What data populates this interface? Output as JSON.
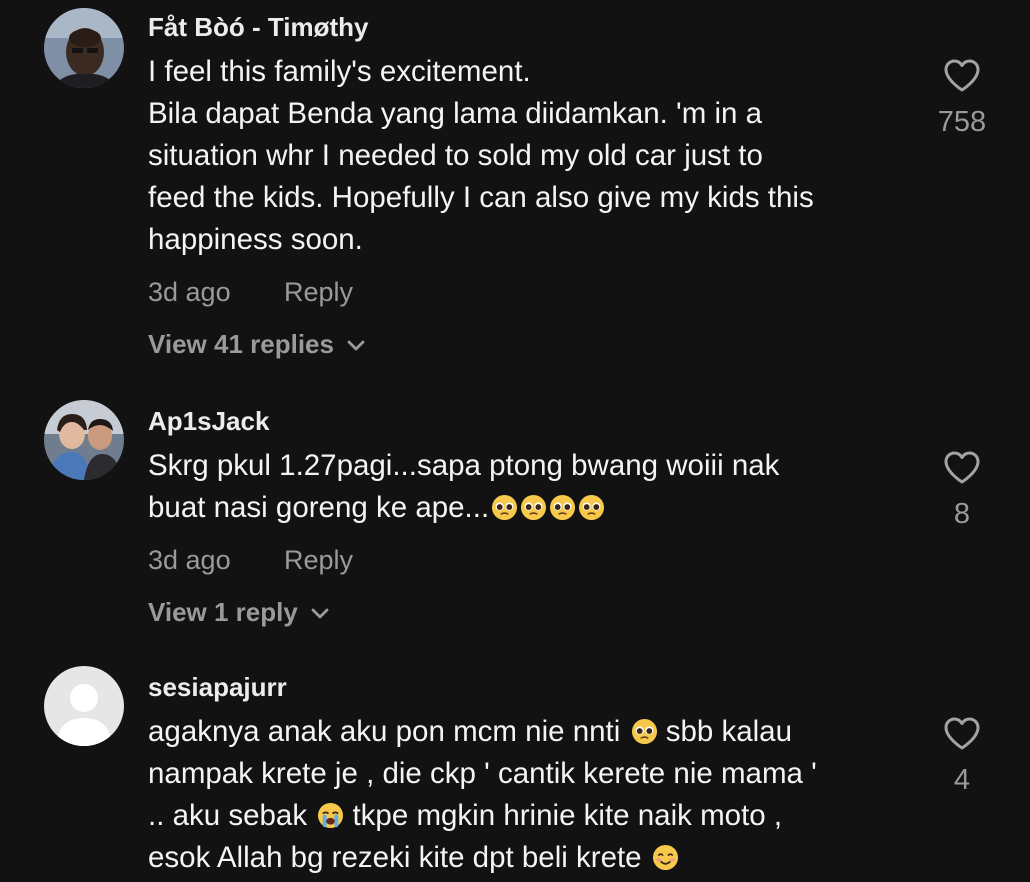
{
  "comments": [
    {
      "username": "Fåt Bòó - Timøthy",
      "lines": [
        "I feel this family's excitement.",
        "Bila dapat Benda yang lama diidamkan. 'm in a",
        "situation whr I needed to sold my old car just to",
        "feed the kids. Hopefully I can also give my kids this",
        "happiness soon."
      ],
      "time": "3d ago",
      "reply_label": "Reply",
      "view_replies": "View 41 replies",
      "likes": "758",
      "avatar": "man-photo"
    },
    {
      "username": "Ap1sJack",
      "line1": "Skrg pkul 1.27pagi...sapa ptong bwang woiii nak",
      "line2": "buat nasi goreng ke ape...",
      "line2_emojis": [
        "pleading-face",
        "pleading-face",
        "pleading-face",
        "pleading-face"
      ],
      "time": "3d ago",
      "reply_label": "Reply",
      "view_replies": "View 1 reply",
      "likes": "8",
      "avatar": "couple-photo"
    },
    {
      "username": "sesiapajurr",
      "line1a": "agaknya anak aku pon mcm nie nnti",
      "line1b": "sbb kalau",
      "line2": "nampak krete je , die ckp ' cantik kerete nie mama '",
      "line3a": ".. aku sebak",
      "line3b": "tkpe mgkin hrinie kite naik moto ,",
      "line4": "esok Allah bg rezeki kite dpt beli krete",
      "likes": "4",
      "avatar": "default-avatar"
    }
  ],
  "colors": {
    "background": "#121212",
    "text": "#f4f4f4",
    "muted": "#9a9a9a"
  }
}
